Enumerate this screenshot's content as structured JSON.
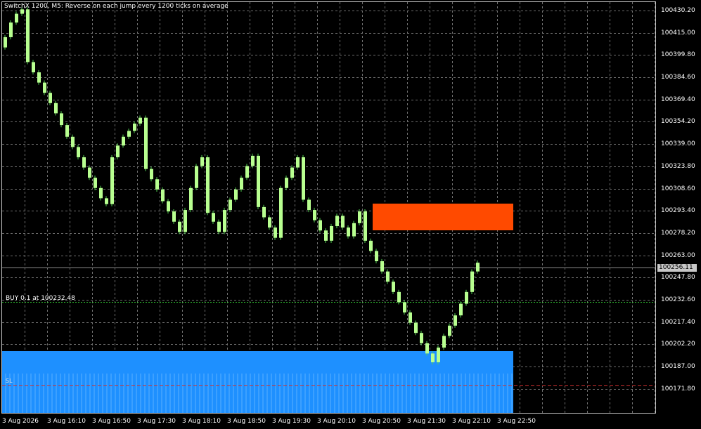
{
  "chart": {
    "title": "SwitchX 1200, M5:  Reverse on each jump every 1200 ticks on average",
    "trade_label": "BUY 0.1 at 100232.48",
    "sl_label": "SL",
    "current_price": "100256.11",
    "price_axis": [
      "100430.20",
      "100415.00",
      "100399.80",
      "100384.60",
      "100369.40",
      "100354.20",
      "100339.00",
      "100323.80",
      "100308.60",
      "100293.40",
      "100278.20",
      "100263.00",
      "100247.80",
      "100232.60",
      "100217.40",
      "100202.20",
      "100187.00",
      "100171.80"
    ],
    "time_axis": [
      "3 Aug 2026",
      "3 Aug 16:10",
      "3 Aug 16:50",
      "3 Aug 17:30",
      "3 Aug 18:10",
      "3 Aug 18:50",
      "3 Aug 19:30",
      "3 Aug 20:10",
      "3 Aug 20:50",
      "3 Aug 21:30",
      "3 Aug 22:10",
      "3 Aug 22:50"
    ],
    "colors": {
      "background": "#000000",
      "grid": "#6e6e6e",
      "candle": "#b8ff90",
      "wick": "#4fd04f",
      "sell_zone": "#ff4a00",
      "buy_zone": "#1e90ff",
      "entry_line": "#30c030",
      "sl_line": "#d03030",
      "price_line": "#8c8c8c"
    }
  },
  "chart_data": {
    "type": "candlestick",
    "ylim": [
      100165,
      100436
    ],
    "closes": [
      100412,
      100422,
      100428,
      100431,
      100395,
      100388,
      100381,
      100374,
      100367,
      100360,
      100352,
      100344,
      100337,
      100330,
      100323,
      100316,
      100309,
      100302,
      100298,
      100330,
      100338,
      100344,
      100348,
      100353,
      100357,
      100322,
      100315,
      100308,
      100300,
      100293,
      100286,
      100279,
      100294,
      100309,
      100324,
      100330,
      100292,
      100286,
      100279,
      100294,
      100301,
      100308,
      100316,
      100324,
      100331,
      100296,
      100289,
      100282,
      100275,
      100309,
      100316,
      100323,
      100330,
      100301,
      100294,
      100287,
      100280,
      100273,
      100283,
      100290,
      100282,
      100276,
      100285,
      100293,
      100273,
      100266,
      100259,
      100252,
      100245,
      100238,
      100231,
      100224,
      100217,
      100210,
      100203,
      100196,
      100190,
      100200,
      100208,
      100215,
      100222,
      100230,
      100238,
      100252,
      100258
    ]
  }
}
